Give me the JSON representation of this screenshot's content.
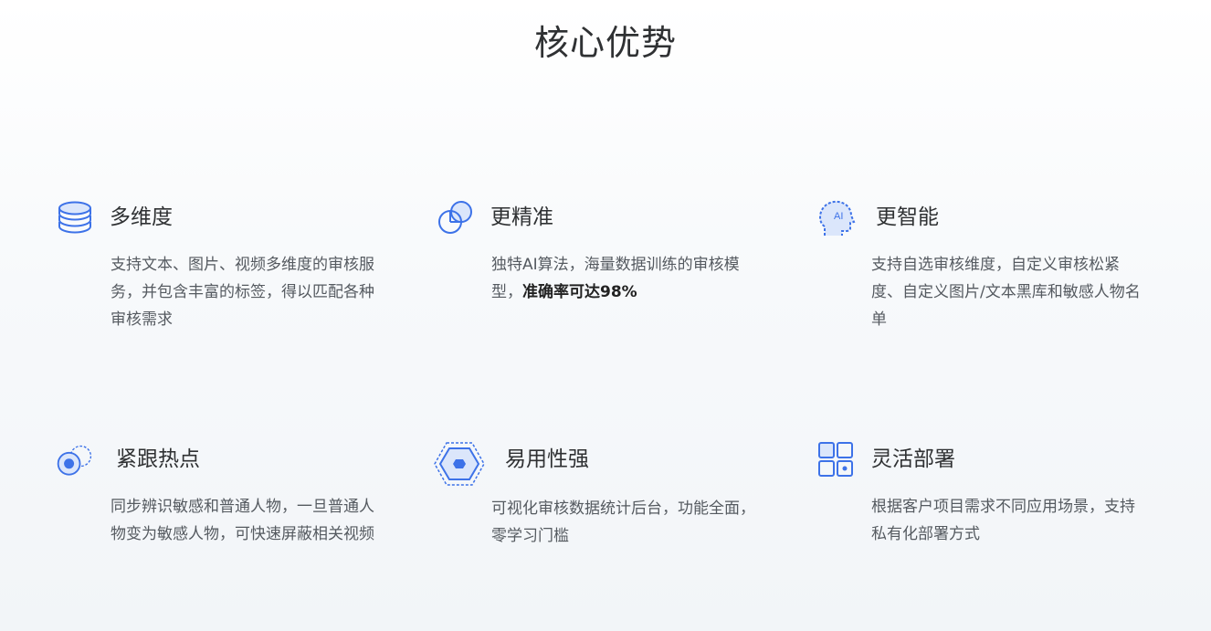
{
  "page_title": "核心优势",
  "colors": {
    "accent": "#3d72e8",
    "accent_light": "#dbe6fb",
    "title_text": "#2f3133",
    "body_text": "#555a60"
  },
  "features": [
    {
      "icon": "database-stack-icon",
      "title": "多维度",
      "desc": "支持文本、图片、视频多维度的审核服务，并包含丰富的标签，得以匹配各种审核需求"
    },
    {
      "icon": "overlapping-circles-icon",
      "title": "更精准",
      "desc": "独特AI算法，海量数据训练的审核模型，",
      "desc_strong": "准确率可达98%"
    },
    {
      "icon": "ai-head-icon",
      "icon_text": "AI",
      "title": "更智能",
      "desc": "支持自选审核维度，自定义审核松紧度、自定义图片/文本黑库和敏感人物名单"
    },
    {
      "icon": "target-dot-icon",
      "title": "紧跟热点",
      "desc": "同步辨识敏感和普通人物，一旦普通人物变为敏感人物，可快速屏蔽相关视频"
    },
    {
      "icon": "hexagon-icon",
      "title": "易用性强",
      "desc": "可视化审核数据统计后台，功能全面，零学习门槛"
    },
    {
      "icon": "grid-squares-icon",
      "title": "灵活部署",
      "desc": "根据客户项目需求不同应用场景，支持私有化部署方式"
    }
  ]
}
